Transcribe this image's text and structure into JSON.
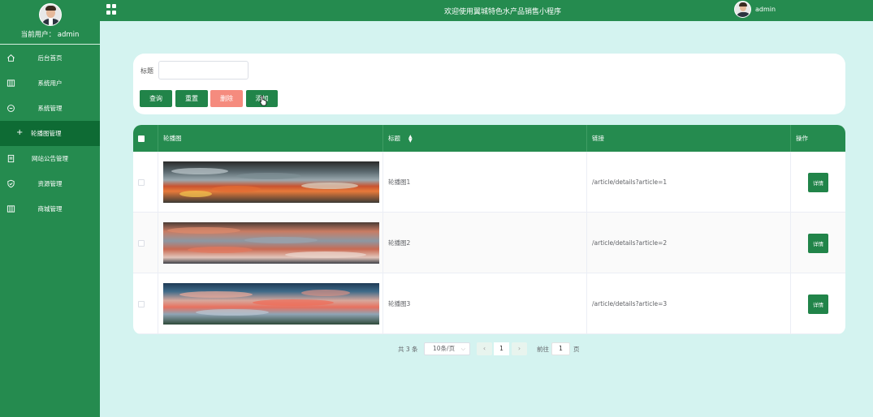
{
  "sidebar": {
    "username": "当前用户：  admin",
    "items": [
      {
        "label": "后台首页",
        "icon": "home-icon"
      },
      {
        "label": "系统用户",
        "icon": "columns-icon"
      },
      {
        "label": "系统管理",
        "icon": "chat-icon"
      },
      {
        "label": "轮播图管理",
        "icon": "plus-icon",
        "active": true
      },
      {
        "label": "网站公告管理",
        "icon": "document-icon"
      },
      {
        "label": "资源管理",
        "icon": "shield-icon"
      },
      {
        "label": "商城管理",
        "icon": "columns-icon"
      }
    ]
  },
  "topbar": {
    "title": "欢迎使用翼城特色水产品销售小程序",
    "user": "admin"
  },
  "search": {
    "label": "标题",
    "value": "",
    "query_label": "查询",
    "reset_label": "重置",
    "delete_label": "删除",
    "add_label": "添加"
  },
  "table": {
    "headers": {
      "image": "轮播图",
      "title": "标题",
      "link": "链接",
      "action": "操作"
    },
    "rows": [
      {
        "title": "轮播图1",
        "link": "/article/details?article=1",
        "action": "详情"
      },
      {
        "title": "轮播图2",
        "link": "/article/details?article=2",
        "action": "详情"
      },
      {
        "title": "轮播图3",
        "link": "/article/details?article=3",
        "action": "详情"
      }
    ]
  },
  "pagination": {
    "total": "共 3 条",
    "page_size": "10条/页",
    "current_page": "1",
    "goto_label": "前往",
    "goto_value": "1",
    "page_suffix": "页"
  },
  "colors": {
    "primary": "#258b4f",
    "active_menu": "#0e6b34",
    "background": "#d4f3f0",
    "delete": "#f58b7e"
  }
}
